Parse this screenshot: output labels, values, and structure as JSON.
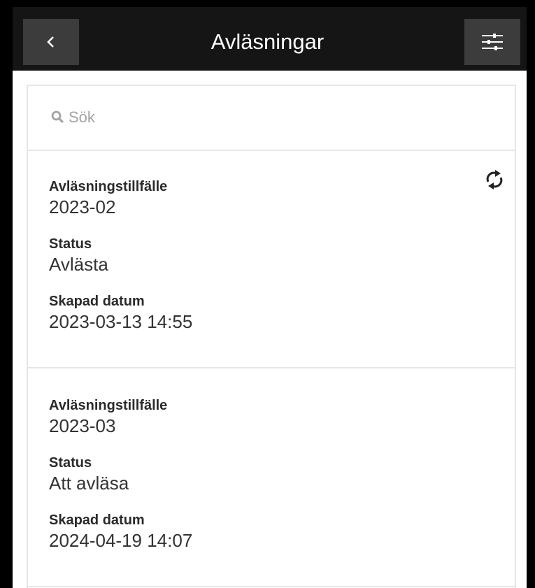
{
  "header": {
    "title": "Avläsningar",
    "back_icon": "chevron-left-icon",
    "filter_icon": "sliders-icon"
  },
  "search": {
    "placeholder": "Sök",
    "value": "",
    "icon": "search-icon"
  },
  "records": [
    {
      "labels": {
        "occasion": "Avläsningstillfälle",
        "status": "Status",
        "created": "Skapad datum"
      },
      "occasion": "2023-02",
      "status": "Avlästa",
      "created": "2023-03-13 14:55",
      "icon": "sync-icon"
    },
    {
      "labels": {
        "occasion": "Avläsningstillfälle",
        "status": "Status",
        "created": "Skapad datum"
      },
      "occasion": "2023-03",
      "status": "Att avläsa",
      "created": "2024-04-19 14:07"
    }
  ],
  "colors": {
    "header_bg": "#151515",
    "header_button_bg": "#3c3c3c",
    "text": "#333333",
    "divider": "#e6e6e6"
  }
}
